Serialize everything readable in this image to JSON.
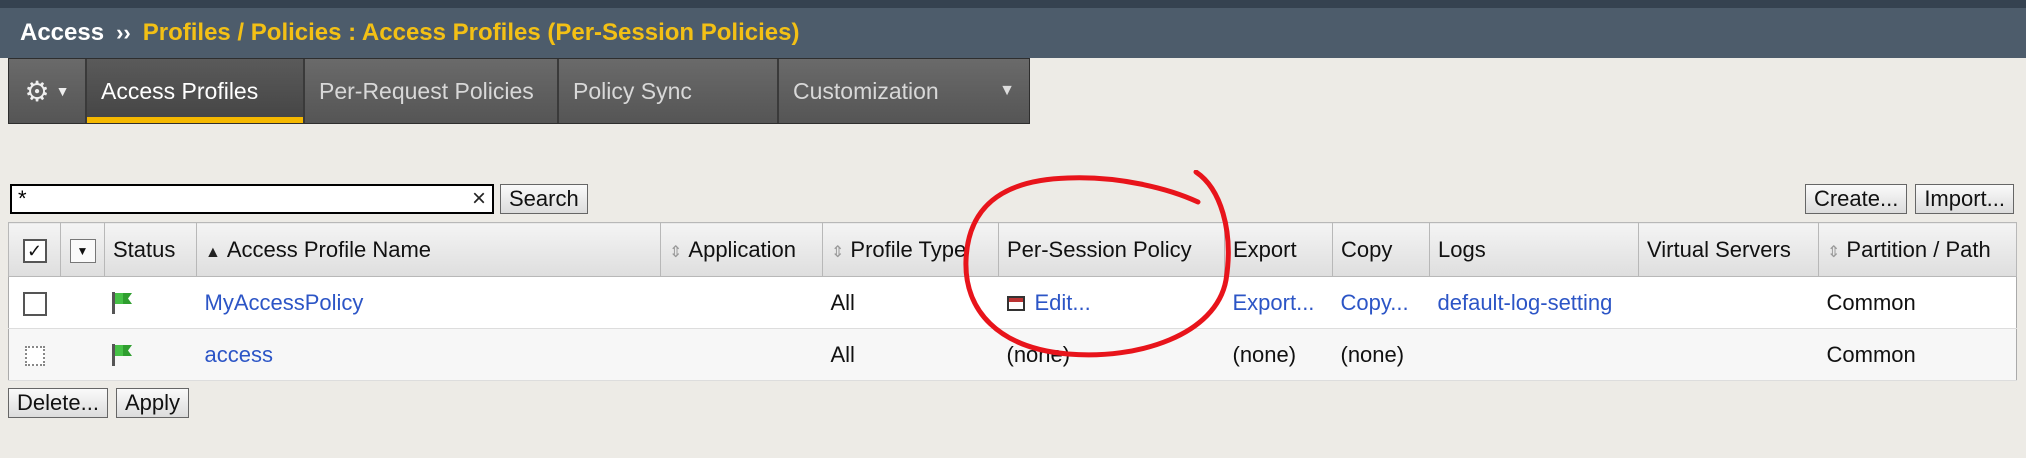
{
  "breadcrumb": {
    "root": "Access",
    "separator": "››",
    "path": "Profiles / Policies : Access Profiles (Per-Session Policies)"
  },
  "tabs": [
    {
      "label": "Access Profiles",
      "active": true
    },
    {
      "label": "Per-Request Policies",
      "active": false
    },
    {
      "label": "Policy Sync",
      "active": false
    },
    {
      "label": "Customization",
      "active": false
    }
  ],
  "search": {
    "value": "*",
    "clear_label": "×",
    "button_label": "Search"
  },
  "actions": {
    "create_label": "Create...",
    "import_label": "Import..."
  },
  "table": {
    "headers": {
      "status": "Status",
      "name": "Access Profile Name",
      "application": "Application",
      "profile_type": "Profile Type",
      "per_session_policy": "Per-Session Policy",
      "export": "Export",
      "copy": "Copy",
      "logs": "Logs",
      "virtual_servers": "Virtual Servers",
      "partition": "Partition / Path"
    },
    "rows": [
      {
        "name": "MyAccessPolicy",
        "application": "",
        "profile_type": "All",
        "per_session_policy": "Edit...",
        "export": "Export...",
        "copy": "Copy...",
        "logs": "default-log-setting",
        "virtual_servers": "",
        "partition": "Common"
      },
      {
        "name": "access",
        "application": "",
        "profile_type": "All",
        "per_session_policy": "(none)",
        "export": "(none)",
        "copy": "(none)",
        "logs": "",
        "virtual_servers": "",
        "partition": "Common"
      }
    ]
  },
  "footer": {
    "delete_label": "Delete...",
    "apply_label": "Apply"
  },
  "colors": {
    "breadcrumb_bg": "#4d5c6b",
    "breadcrumb_accent": "#f3c015",
    "active_tab_underline": "#f5b800",
    "link": "#2c55c6",
    "annotation": "#e8141b"
  },
  "icons": {
    "gear": "gear-icon",
    "status_flag": "green-flag-icon",
    "edit": "edit-window-icon"
  }
}
